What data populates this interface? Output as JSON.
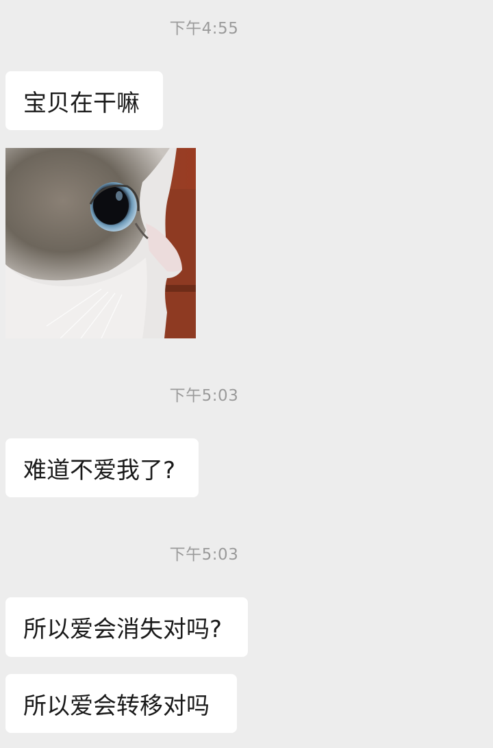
{
  "messages": [
    {
      "type": "timestamp",
      "text": "下午4:55"
    },
    {
      "type": "text",
      "text": "宝贝在干嘛"
    },
    {
      "type": "image",
      "subject": "cat-photo"
    },
    {
      "type": "timestamp",
      "text": "下午5:03"
    },
    {
      "type": "text",
      "text": "难道不爱我了?"
    },
    {
      "type": "timestamp",
      "text": "下午5:03"
    },
    {
      "type": "text",
      "text": "所以爱会消失对吗?"
    },
    {
      "type": "text",
      "text": "所以爱会转移对吗"
    }
  ],
  "colors": {
    "background": "#ededed",
    "bubble": "#ffffff",
    "timestamp_text": "#9a9a9a",
    "message_text": "#191919"
  }
}
